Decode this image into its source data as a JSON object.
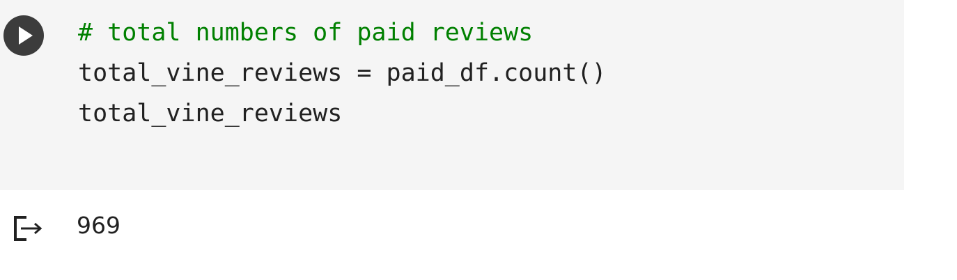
{
  "cell": {
    "code_lines": [
      {
        "text": "# total numbers of paid reviews",
        "kind": "comment"
      },
      {
        "text": "total_vine_reviews = paid_df.count()",
        "kind": "code"
      },
      {
        "text": "total_vine_reviews",
        "kind": "code"
      }
    ],
    "run_icon": "play-icon"
  },
  "output": {
    "icon": "output-arrow-icon",
    "value": "969"
  },
  "colors": {
    "cell_background": "#f5f5f5",
    "comment": "#008000",
    "code_text": "#212121",
    "run_button": "#3c3c3c"
  }
}
